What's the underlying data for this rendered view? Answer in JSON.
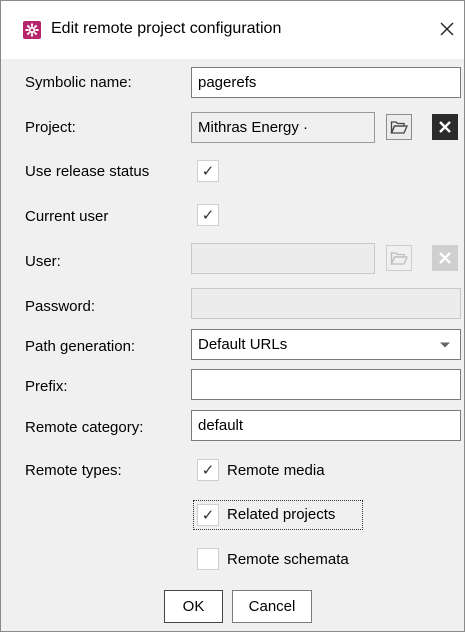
{
  "window": {
    "title": "Edit remote project configuration",
    "close_glyph": "✕",
    "icon": "gear-icon"
  },
  "form": {
    "symbolic_name": {
      "label": "Symbolic name:",
      "value": "pagerefs"
    },
    "project": {
      "label": "Project:",
      "value": "Mithras Energy ·"
    },
    "use_release_status": {
      "label": "Use release status",
      "checked": true
    },
    "current_user": {
      "label": "Current user",
      "checked": true
    },
    "user": {
      "label": "User:",
      "value": ""
    },
    "password": {
      "label": "Password:",
      "value": ""
    },
    "path_generation": {
      "label": "Path generation:",
      "selected": "Default URLs"
    },
    "prefix": {
      "label": "Prefix:",
      "value": ""
    },
    "remote_category": {
      "label": "Remote category:",
      "value": "default"
    },
    "remote_types": {
      "label": "Remote types:",
      "options": [
        {
          "label": "Remote media",
          "checked": true
        },
        {
          "label": "Related projects",
          "checked": true
        },
        {
          "label": "Remote schemata",
          "checked": false
        }
      ]
    }
  },
  "checkmark": "✓",
  "buttons": {
    "ok": "OK",
    "cancel": "Cancel"
  },
  "colors": {
    "app_icon": "#b5256c",
    "dialog_bg": "#f0f0f0",
    "clear_button": "#2b2b2b"
  }
}
